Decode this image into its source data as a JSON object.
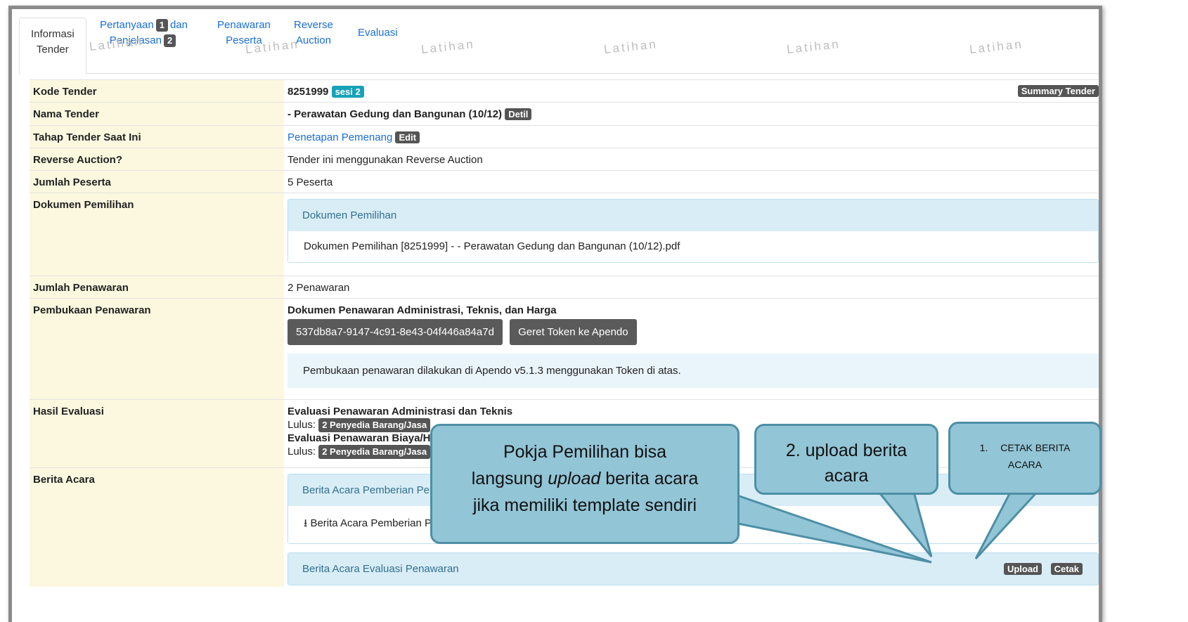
{
  "tabs": {
    "informasi": "Informasi\nTender",
    "pertanyaan_a": "Pertanyaan",
    "pertanyaan_n1": "1",
    "pertanyaan_b": "dan",
    "penjelasan": "Penjelasan",
    "penjelasan_n": "2",
    "penawaran": "Penawaran\nPeserta",
    "reverse": "Reverse\nAuction",
    "evaluasi": "Evaluasi"
  },
  "watermark": "Latihan",
  "rows": {
    "kode": {
      "label": "Kode Tender",
      "value": "8251999",
      "badge": "sesi 2",
      "summary": "Summary Tender"
    },
    "nama": {
      "label": "Nama Tender",
      "value": "- Perawatan Gedung dan Bangunan (10/12)",
      "detil": "Detil"
    },
    "tahap": {
      "label": "Tahap Tender Saat Ini",
      "value": "Penetapan Pemenang",
      "edit": "Edit"
    },
    "reverse": {
      "label": "Reverse Auction?",
      "value": "Tender ini menggunakan Reverse Auction"
    },
    "peserta": {
      "label": "Jumlah Peserta",
      "value": "5 Peserta"
    },
    "dokumen": {
      "label": "Dokumen Pemilihan",
      "panel_title": "Dokumen Pemilihan",
      "file": "Dokumen Pemilihan [8251999] - - Perawatan Gedung dan Bangunan (10/12).pdf"
    },
    "jumlah_penawaran": {
      "label": "Jumlah Penawaran",
      "value": "2 Penawaran"
    },
    "pembukaan": {
      "label": "Pembukaan Penawaran",
      "heading": "Dokumen Penawaran Administrasi, Teknis, dan Harga",
      "token": "537db8a7-9147-4c91-8e43-04f446a84a7d",
      "geret": "Geret Token ke Apendo",
      "info": "Pembukaan penawaran dilakukan di Apendo v5.1.3 menggunakan Token di atas."
    },
    "hasil": {
      "label": "Hasil Evaluasi",
      "h1": "Evaluasi Penawaran Administrasi dan Teknis",
      "lulus": "Lulus:",
      "b1": "2 Penyedia Barang/Jasa",
      "h2": "Evaluasi Penawaran Biaya/H",
      "b2": "2 Penyedia Barang/Jasa"
    },
    "berita": {
      "label": "Berita Acara",
      "p1": "Berita Acara Pemberian Pen",
      "p1_item": "Berita Acara Pemberian P",
      "p2": "Berita Acara Evaluasi Penawaran",
      "upload": "Upload",
      "cetak": "Cetak"
    }
  },
  "callouts": {
    "c1_line1": "Pokja Pemilihan bisa",
    "c1_line2a": "langsung ",
    "c1_line2b": "upload",
    "c1_line2c": " berita acara",
    "c1_line3": "jika memiliki template sendiri",
    "c2": "2. upload berita acara",
    "c3_num": "1.",
    "c3_text": "CETAK BERITA ACARA"
  }
}
